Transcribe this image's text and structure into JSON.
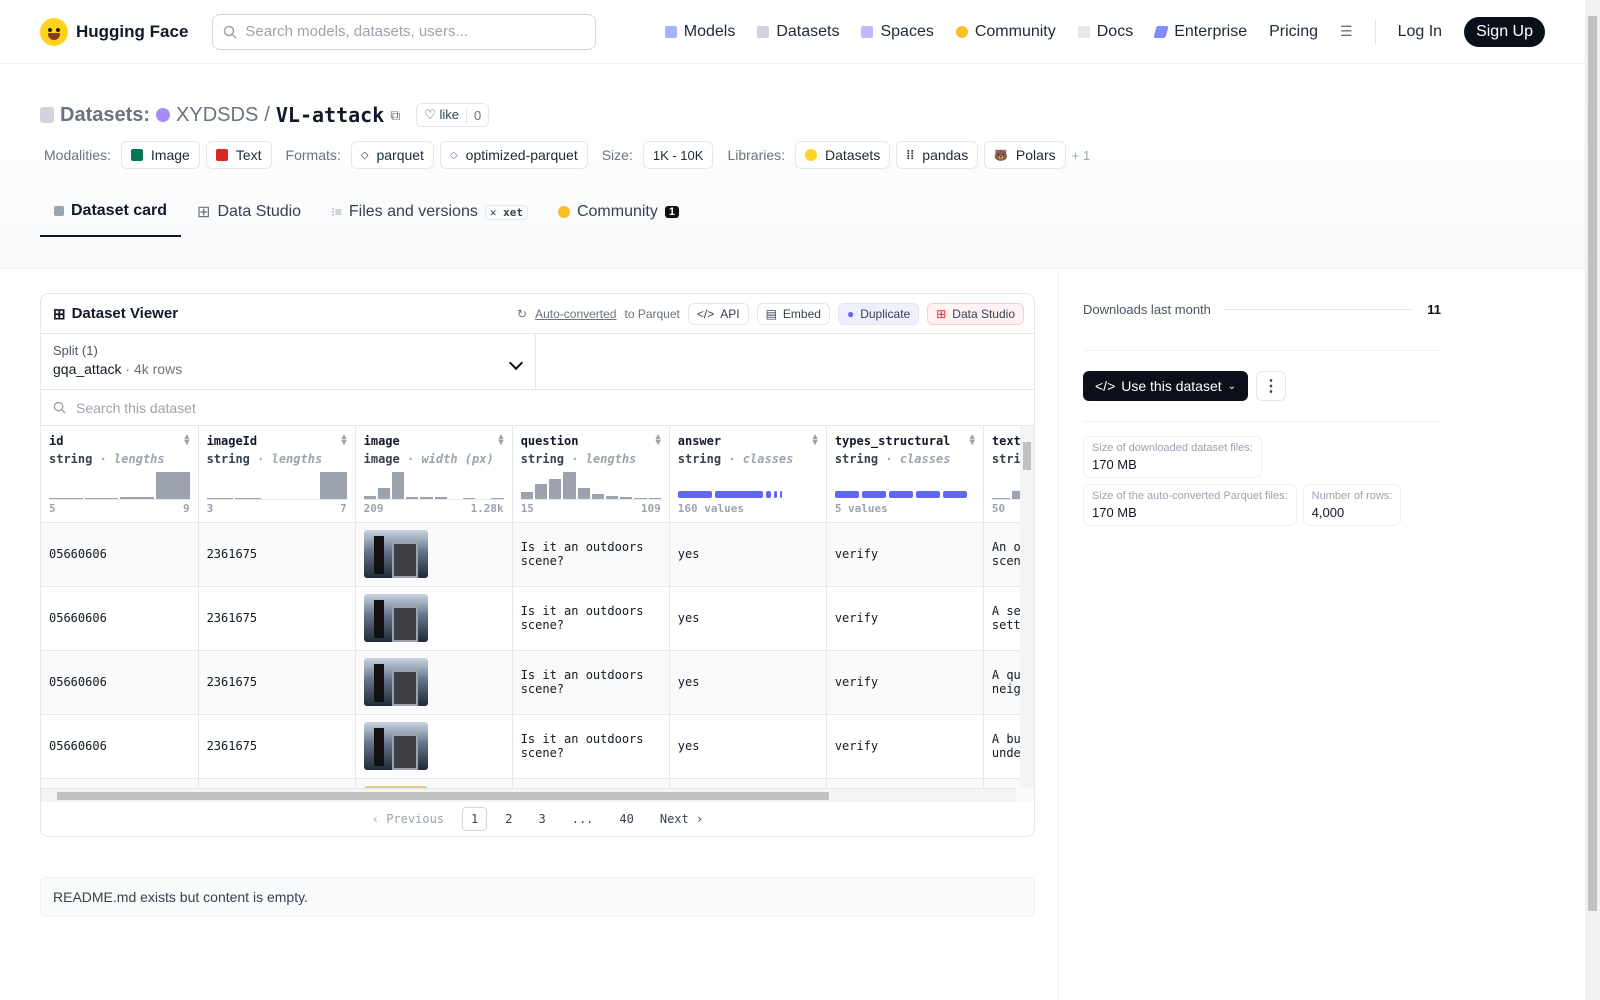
{
  "nav": {
    "brand": "Hugging Face",
    "search_placeholder": "Search models, datasets, users...",
    "links": [
      "Models",
      "Datasets",
      "Spaces",
      "Community",
      "Docs",
      "Enterprise",
      "Pricing"
    ],
    "login": "Log In",
    "signup": "Sign Up"
  },
  "repo": {
    "category": "Datasets:",
    "owner": "XYDSDS",
    "sep": "/",
    "name": "VL-attack",
    "like_label": "like",
    "like_count": "0"
  },
  "tags": {
    "modalities_label": "Modalities:",
    "modalities": [
      "Image",
      "Text"
    ],
    "formats_label": "Formats:",
    "formats": [
      "parquet",
      "optimized-parquet"
    ],
    "size_label": "Size:",
    "size": "1K - 10K",
    "libraries_label": "Libraries:",
    "libraries": [
      "Datasets",
      "pandas",
      "Polars"
    ],
    "more": "+ 1"
  },
  "tabs": {
    "card": "Dataset card",
    "studio": "Data Studio",
    "files": "Files and versions",
    "xet": "xet",
    "community": "Community",
    "community_count": "1"
  },
  "viewer": {
    "title": "Dataset Viewer",
    "auto_link": "Auto-converted",
    "auto_rest": "to Parquet",
    "api": "API",
    "embed": "Embed",
    "duplicate": "Duplicate",
    "data_studio": "Data Studio",
    "split_label": "Split (1)",
    "split_name": "gqa_attack",
    "split_rows": "4k rows",
    "search_placeholder": "Search this dataset",
    "columns": [
      {
        "name": "id",
        "type": "string",
        "stat": "lengths",
        "min": "5",
        "max": "9",
        "kind": "hist",
        "bars": [
          0.05,
          0.05,
          0.08,
          1
        ]
      },
      {
        "name": "imageId",
        "type": "string",
        "stat": "lengths",
        "min": "3",
        "max": "7",
        "kind": "hist",
        "bars": [
          0.05,
          0.05,
          0,
          0,
          1
        ]
      },
      {
        "name": "image",
        "type": "image",
        "stat": "width (px)",
        "min": "209",
        "max": "1.28k",
        "kind": "hist",
        "bars": [
          0.1,
          0.4,
          1,
          0.08,
          0.08,
          0.08,
          0,
          0.05,
          0,
          0.05
        ]
      },
      {
        "name": "question",
        "type": "string",
        "stat": "lengths",
        "min": "15",
        "max": "109",
        "kind": "hist",
        "bars": [
          0.25,
          0.55,
          0.75,
          1,
          0.4,
          0.2,
          0.12,
          0.06,
          0.04,
          0.04
        ]
      },
      {
        "name": "answer",
        "type": "string",
        "stat": "classes",
        "min": "160 values",
        "max": "",
        "kind": "classes",
        "classes": [
          34,
          48,
          5,
          3,
          2
        ]
      },
      {
        "name": "types_structural",
        "type": "string",
        "stat": "classes",
        "min": "5 values",
        "max": "",
        "kind": "classes",
        "classes": [
          24,
          24,
          24,
          24,
          24
        ]
      },
      {
        "name": "text",
        "type": "string",
        "stat": "lengths",
        "min": "50",
        "max": "",
        "kind": "hist",
        "bars": [
          0.05,
          0.3,
          0.8,
          1,
          0.6,
          0.25,
          0.08
        ]
      }
    ],
    "rows": [
      [
        "05660606",
        "2361675",
        "",
        "Is it an outdoors scene?",
        "yes",
        "verify",
        "An outdoor urban scene featuring"
      ],
      [
        "05660606",
        "2361675",
        "",
        "Is it an outdoors scene?",
        "yes",
        "verify",
        "A serene indoor setting with"
      ],
      [
        "05660606",
        "2361675",
        "",
        "Is it an outdoors scene?",
        "yes",
        "verify",
        "A quiet suburban neighborhood"
      ],
      [
        "05660606",
        "2361675",
        "",
        "Is it an outdoors scene?",
        "yes",
        "verify",
        "A bustling underground station"
      ]
    ],
    "pager": {
      "prev": "Previous",
      "pages": [
        "1",
        "2",
        "3",
        "...",
        "40"
      ],
      "next": "Next"
    }
  },
  "readme": "README.md exists but content is empty.",
  "sidebar": {
    "downloads_label": "Downloads last month",
    "downloads": "11",
    "use_label": "Use this dataset",
    "stats": [
      {
        "label": "Size of downloaded dataset files:",
        "value": "170 MB"
      },
      {
        "label": "Size of the auto-converted Parquet files:",
        "value": "170 MB"
      },
      {
        "label": "Number of rows:",
        "value": "4,000"
      }
    ]
  },
  "colors": {
    "accent": "#6366f1",
    "dark": "#0b0f19",
    "brand": "#ffd21e"
  }
}
